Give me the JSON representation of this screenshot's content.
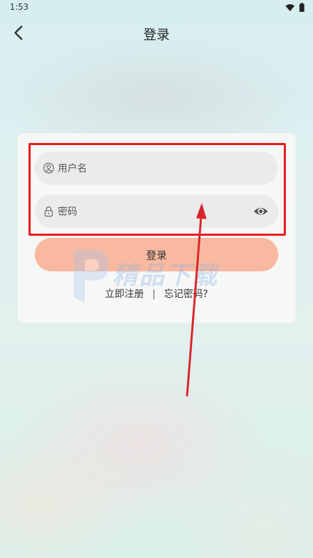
{
  "status_bar": {
    "time": "1:53",
    "icons": [
      "wifi-icon",
      "battery-icon"
    ]
  },
  "header": {
    "title": "登录",
    "back_icon": "chevron-left-icon"
  },
  "login_form": {
    "username": {
      "placeholder": "用户名",
      "value": "",
      "icon": "user-icon"
    },
    "password": {
      "placeholder": "密码",
      "value": "",
      "icon": "lock-icon",
      "toggle_icon": "eye-icon"
    },
    "login_button_label": "登录",
    "register_link": "立即注册",
    "separator": "|",
    "forgot_link": "忘记密码?"
  },
  "watermark": {
    "text": "精品下载"
  },
  "annotation": {
    "box_color": "#e8171b",
    "arrow_color": "#d9252b"
  },
  "colors": {
    "login_button": "#f9b9a0",
    "field_background": "#ebebeb",
    "card_background": "#f7f7f7"
  }
}
